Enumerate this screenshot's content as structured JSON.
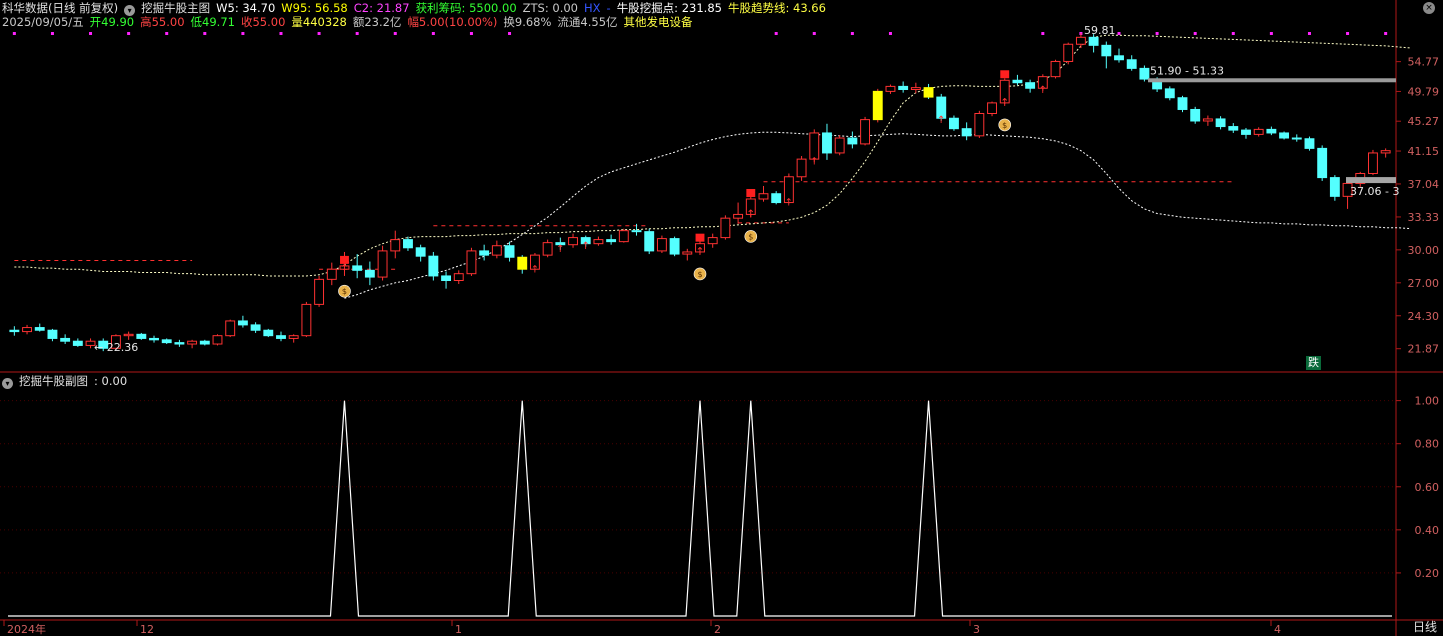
{
  "header": {
    "title": "科华数据(日线 前复权)",
    "indicator_name": "挖掘牛股主图",
    "items": [
      {
        "text": "W5: 34.70",
        "color": "#ffffff"
      },
      {
        "text": "W95: 56.58",
        "color": "#ffff00"
      },
      {
        "text": "C2: 21.87",
        "color": "#ff44ff"
      },
      {
        "text": "获利筹码: 5500.00",
        "color": "#33ff33"
      },
      {
        "text": "ZTS: 0.00",
        "color": "#c8c8c8"
      },
      {
        "text": "HX",
        "color": "#3355ff"
      },
      {
        "text": "-",
        "color": "#3355ff"
      },
      {
        "text": "牛股挖掘点: 231.85",
        "color": "#ffffff"
      },
      {
        "text": "牛股趋势线: 43.66",
        "color": "#ffff44"
      }
    ]
  },
  "quote": [
    {
      "text": "2025/09/05/五",
      "color": "#c8c8c8"
    },
    {
      "text": "开49.90",
      "color": "#33ff33"
    },
    {
      "text": "高55.00",
      "color": "#ff4444"
    },
    {
      "text": "低49.71",
      "color": "#33ff33"
    },
    {
      "text": "收55.00",
      "color": "#ff4444"
    },
    {
      "text": "量440328",
      "color": "#ffff44"
    },
    {
      "text": "额23.2亿",
      "color": "#c8c8c8"
    },
    {
      "text": "幅5.00(10.00%)",
      "color": "#ff4444"
    },
    {
      "text": "换9.68%",
      "color": "#c8c8c8"
    },
    {
      "text": "流通4.55亿",
      "color": "#c8c8c8"
    },
    {
      "text": "其他发电设备",
      "color": "#ffff44"
    }
  ],
  "sub_header": {
    "title": "挖掘牛股副图",
    "value": ": 0.00"
  },
  "colors": {
    "up": "#ff3232",
    "down": "#54ffff",
    "axis": "#b01818",
    "grid": "#4a0000",
    "signal_yellow": "#ffff00"
  },
  "chart_data": [
    {
      "type": "candlestick",
      "title": "",
      "y_ticks": [
        54.77,
        49.79,
        45.27,
        41.15,
        37.04,
        33.33,
        30.0,
        27.0,
        24.3,
        21.87
      ],
      "ylim": [
        20.3,
        60.6
      ],
      "x_ticks": [
        "2024年",
        "12",
        "1",
        "2",
        "3",
        "4"
      ],
      "annotations": [
        "22.36",
        "59.81",
        "51.90 - 51.33",
        "37.06 - 3"
      ],
      "badge": "跌",
      "candles": [
        [
          23.2,
          23.5,
          22.8,
          23.1
        ],
        [
          23.1,
          23.6,
          22.9,
          23.4
        ],
        [
          23.4,
          23.7,
          23.1,
          23.2
        ],
        [
          23.2,
          23.3,
          22.4,
          22.6
        ],
        [
          22.6,
          22.9,
          22.2,
          22.4
        ],
        [
          22.4,
          22.6,
          22.0,
          22.1
        ],
        [
          22.1,
          22.6,
          21.9,
          22.4
        ],
        [
          22.4,
          22.6,
          21.7,
          21.9
        ],
        [
          21.9,
          22.9,
          21.8,
          22.8
        ],
        [
          22.8,
          23.1,
          22.5,
          22.9
        ],
        [
          22.9,
          23.0,
          22.5,
          22.6
        ],
        [
          22.6,
          22.8,
          22.3,
          22.5
        ],
        [
          22.5,
          22.6,
          22.2,
          22.3
        ],
        [
          22.3,
          22.5,
          22.0,
          22.2
        ],
        [
          22.2,
          22.5,
          21.9,
          22.4
        ],
        [
          22.4,
          22.5,
          22.1,
          22.2
        ],
        [
          22.2,
          22.9,
          22.1,
          22.8
        ],
        [
          22.8,
          24.0,
          22.7,
          23.9
        ],
        [
          23.9,
          24.3,
          23.4,
          23.6
        ],
        [
          23.6,
          23.8,
          23.0,
          23.2
        ],
        [
          23.2,
          23.3,
          22.7,
          22.8
        ],
        [
          22.8,
          23.1,
          22.4,
          22.6
        ],
        [
          22.6,
          22.9,
          22.3,
          22.8
        ],
        [
          22.8,
          25.4,
          22.7,
          25.2
        ],
        [
          25.2,
          27.6,
          25.0,
          27.3
        ],
        [
          27.3,
          28.8,
          26.8,
          28.2
        ],
        [
          28.2,
          29.8,
          27.6,
          28.5
        ],
        [
          28.5,
          29.6,
          27.4,
          28.1
        ],
        [
          28.1,
          28.9,
          26.8,
          27.5
        ],
        [
          27.5,
          30.4,
          27.2,
          29.9
        ],
        [
          29.9,
          31.9,
          29.2,
          31.0
        ],
        [
          31.0,
          31.3,
          29.9,
          30.2
        ],
        [
          30.2,
          30.5,
          28.9,
          29.4
        ],
        [
          29.4,
          29.8,
          27.2,
          27.6
        ],
        [
          27.6,
          28.0,
          26.5,
          27.2
        ],
        [
          27.2,
          28.1,
          26.9,
          27.8
        ],
        [
          27.8,
          30.2,
          27.6,
          29.9
        ],
        [
          29.9,
          30.5,
          29.0,
          29.5
        ],
        [
          29.5,
          30.9,
          29.2,
          30.4
        ],
        [
          30.4,
          30.8,
          28.9,
          29.3
        ],
        [
          29.3,
          29.5,
          27.8,
          28.2
        ],
        [
          28.2,
          29.7,
          28.1,
          29.5
        ],
        [
          29.5,
          31.0,
          29.3,
          30.7
        ],
        [
          30.7,
          31.2,
          30.0,
          30.5
        ],
        [
          30.5,
          31.6,
          30.2,
          31.2
        ],
        [
          31.2,
          31.4,
          30.3,
          30.6
        ],
        [
          30.6,
          31.3,
          30.4,
          31.0
        ],
        [
          31.0,
          31.5,
          30.5,
          30.8
        ],
        [
          30.8,
          32.1,
          30.7,
          31.9
        ],
        [
          31.9,
          32.6,
          31.4,
          31.8
        ],
        [
          31.8,
          32.1,
          29.6,
          29.9
        ],
        [
          29.9,
          31.4,
          29.7,
          31.1
        ],
        [
          31.1,
          31.3,
          29.4,
          29.6
        ],
        [
          29.6,
          30.1,
          29.0,
          29.8
        ],
        [
          29.8,
          31.0,
          29.6,
          30.6
        ],
        [
          30.6,
          31.6,
          30.2,
          31.2
        ],
        [
          31.2,
          33.5,
          31.0,
          33.2
        ],
        [
          33.2,
          34.9,
          32.6,
          33.6
        ],
        [
          33.6,
          35.8,
          33.3,
          35.3
        ],
        [
          35.3,
          36.8,
          35.0,
          35.9
        ],
        [
          35.9,
          36.2,
          34.7,
          34.9
        ],
        [
          34.9,
          38.3,
          34.8,
          37.9
        ],
        [
          37.9,
          40.5,
          37.4,
          40.1
        ],
        [
          40.1,
          44.1,
          39.7,
          43.6
        ],
        [
          43.6,
          44.9,
          40.0,
          40.9
        ],
        [
          40.9,
          43.3,
          40.6,
          42.9
        ],
        [
          42.9,
          43.8,
          41.5,
          42.1
        ],
        [
          42.1,
          45.9,
          41.9,
          45.5
        ],
        [
          45.5,
          50.2,
          45.1,
          49.8
        ],
        [
          49.8,
          50.9,
          49.4,
          50.6
        ],
        [
          50.6,
          51.4,
          49.6,
          50.1
        ],
        [
          50.1,
          51.2,
          49.5,
          50.4
        ],
        [
          50.4,
          51.0,
          48.6,
          48.9
        ],
        [
          48.9,
          49.4,
          45.3,
          45.7
        ],
        [
          45.7,
          46.1,
          43.9,
          44.2
        ],
        [
          44.2,
          45.1,
          42.6,
          43.2
        ],
        [
          43.2,
          46.8,
          42.9,
          46.4
        ],
        [
          46.4,
          48.2,
          46.0,
          48.0
        ],
        [
          48.0,
          51.9,
          47.8,
          51.6
        ],
        [
          51.6,
          52.5,
          50.8,
          51.2
        ],
        [
          51.2,
          51.7,
          49.6,
          50.3
        ],
        [
          50.3,
          52.6,
          49.9,
          52.2
        ],
        [
          52.2,
          55.1,
          51.9,
          54.8
        ],
        [
          54.8,
          58.2,
          54.3,
          57.9
        ],
        [
          57.9,
          60.0,
          57.2,
          59.2
        ],
        [
          59.2,
          59.8,
          56.4,
          57.7
        ],
        [
          57.7,
          58.4,
          53.6,
          55.8
        ],
        [
          55.8,
          57.1,
          54.6,
          55.1
        ],
        [
          55.1,
          55.9,
          53.2,
          53.6
        ],
        [
          53.6,
          54.1,
          51.4,
          51.8
        ],
        [
          51.8,
          52.1,
          49.7,
          50.2
        ],
        [
          50.2,
          50.6,
          48.4,
          48.8
        ],
        [
          48.8,
          49.1,
          46.6,
          47.0
        ],
        [
          47.0,
          47.4,
          44.9,
          45.3
        ],
        [
          45.3,
          46.1,
          44.6,
          45.6
        ],
        [
          45.6,
          46.0,
          44.1,
          44.5
        ],
        [
          44.5,
          45.0,
          43.6,
          44.0
        ],
        [
          44.0,
          44.3,
          42.8,
          43.4
        ],
        [
          43.4,
          44.4,
          43.1,
          44.1
        ],
        [
          44.1,
          44.5,
          43.3,
          43.6
        ],
        [
          43.6,
          43.8,
          42.7,
          42.9
        ],
        [
          42.9,
          43.4,
          42.4,
          42.8
        ],
        [
          42.8,
          43.1,
          41.2,
          41.5
        ],
        [
          41.5,
          41.9,
          37.4,
          37.8
        ],
        [
          37.8,
          38.1,
          35.1,
          35.6
        ],
        [
          35.6,
          37.4,
          34.2,
          37.1
        ],
        [
          37.1,
          38.5,
          36.7,
          38.3
        ],
        [
          38.3,
          41.3,
          38.1,
          40.9
        ],
        [
          40.9,
          41.5,
          40.3,
          41.2
        ]
      ],
      "series": [
        {
          "values": [
            28.4,
            28.4,
            28.3,
            28.3,
            28.2,
            28.2,
            28.1,
            28.0,
            28.0,
            28.0,
            27.9,
            27.9,
            27.9,
            27.8,
            27.8,
            27.7,
            27.7,
            27.7,
            27.7,
            27.7,
            27.6,
            27.6,
            27.6,
            27.6,
            27.7,
            28.0,
            28.6,
            29.4,
            30.1,
            30.6,
            31.0,
            31.2,
            31.3,
            31.3,
            31.3,
            31.4,
            31.4,
            31.5,
            31.5,
            31.6,
            31.6,
            31.6,
            31.7,
            31.7,
            31.8,
            31.8,
            31.9,
            31.9,
            32.0,
            32.0,
            32.1,
            32.1,
            32.2,
            32.2,
            32.3,
            32.3,
            32.4,
            32.5,
            32.6,
            32.7,
            32.8,
            33.0,
            33.3,
            33.8,
            34.6,
            35.9,
            37.7,
            39.8,
            42.4,
            45.3,
            48.0,
            49.6,
            50.3,
            50.6,
            50.7,
            50.7,
            50.6,
            50.6,
            50.6,
            50.7,
            51.0,
            51.6,
            52.8,
            55.0,
            57.6,
            59.2,
            59.6,
            59.6,
            59.5,
            59.5,
            59.4,
            59.3,
            59.2,
            59.1,
            59.0,
            58.9,
            58.8,
            58.7,
            58.6,
            58.5,
            58.4,
            58.3,
            58.2,
            58.1,
            58.0,
            57.9,
            57.8,
            57.7,
            57.6,
            57.4,
            57.2
          ]
        },
        {
          "values": [
            21.5,
            21.6,
            21.7,
            21.8,
            21.9,
            22.0,
            22.1,
            22.2,
            22.3,
            22.4,
            22.5,
            22.6,
            22.7,
            22.8,
            22.9,
            23.0,
            23.1,
            23.3,
            23.5,
            23.7,
            23.9,
            24.1,
            24.3,
            24.6,
            24.9,
            25.3,
            25.7,
            26.0,
            26.4,
            26.7,
            27.0,
            27.2,
            27.5,
            27.8,
            28.1,
            28.5,
            28.9,
            29.4,
            30.0,
            30.7,
            31.5,
            32.4,
            33.3,
            34.4,
            35.6,
            36.8,
            37.8,
            38.5,
            39.0,
            39.5,
            40.0,
            40.5,
            41.0,
            41.6,
            42.2,
            42.7,
            43.1,
            43.4,
            43.6,
            43.7,
            43.7,
            43.6,
            43.5,
            43.4,
            43.3,
            43.2,
            43.1,
            43.2,
            43.3,
            43.4,
            43.5,
            43.4,
            43.3,
            43.2,
            43.2,
            43.3,
            43.4,
            43.3,
            43.2,
            43.1,
            43.0,
            42.8,
            42.5,
            42.0,
            41.2,
            40.0,
            38.3,
            36.5,
            35.1,
            34.2,
            33.7,
            33.5,
            33.3,
            33.2,
            33.1,
            33.0,
            32.9,
            32.8,
            32.7,
            32.7,
            32.6,
            32.6,
            32.5,
            32.5,
            32.4,
            32.4,
            32.3,
            32.3,
            32.2,
            32.2,
            32.1
          ]
        }
      ]
    },
    {
      "type": "line",
      "title": "",
      "y_ticks": [
        1.0,
        0.8,
        0.6,
        0.4,
        0.2
      ],
      "ylim": [
        0,
        1.04
      ],
      "x": "candle index",
      "pulses": [
        26,
        40,
        54,
        58,
        72
      ]
    }
  ],
  "mode_label": "日线"
}
